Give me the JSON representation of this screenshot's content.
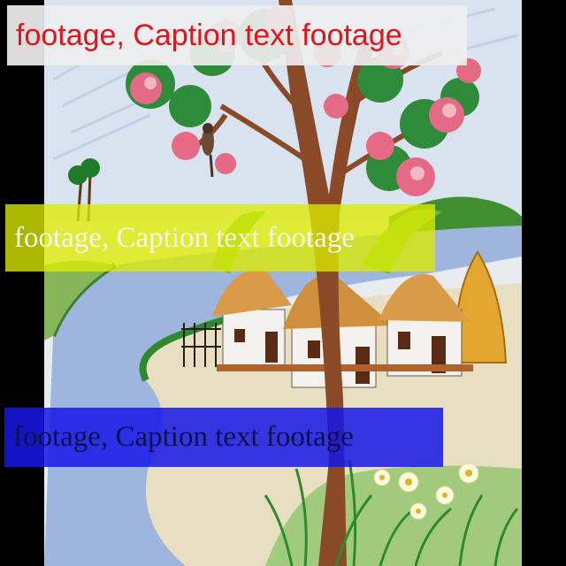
{
  "captions": {
    "top": "footage, Caption text footage",
    "middle": "footage, Caption text footage",
    "bottom": "footage, Caption text footage"
  },
  "colors": {
    "top_box": "#eeeeee",
    "top_text": "#e1141b",
    "middle_box": "#dceb00",
    "middle_text": "#f7f7ef",
    "bottom_box": "#1717e6",
    "bottom_text": "#0d1248"
  },
  "image": {
    "subject": "pencil drawing of a village",
    "icons": [
      "flowering-tree-icon",
      "bird-icon",
      "thatched-hut-icon",
      "haystack-icon",
      "river-icon",
      "palm-tree-icon",
      "fence-icon",
      "daisy-flower-icon"
    ]
  }
}
